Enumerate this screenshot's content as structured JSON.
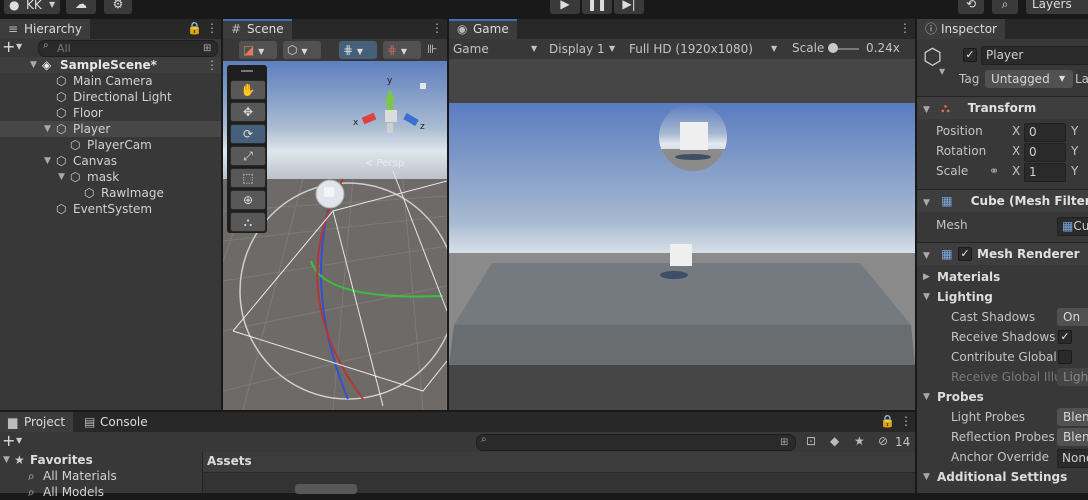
{
  "topbar": {
    "account": "KK",
    "layers": "Layers"
  },
  "hierarchy": {
    "tab": "Hierarchy",
    "search_placeholder": "All",
    "scene": "SampleScene*",
    "items": [
      {
        "label": "Main Camera"
      },
      {
        "label": "Directional Light"
      },
      {
        "label": "Floor"
      },
      {
        "label": "Player"
      },
      {
        "label": "PlayerCam"
      },
      {
        "label": "Canvas"
      },
      {
        "label": "mask"
      },
      {
        "label": "RawImage"
      },
      {
        "label": "EventSystem"
      }
    ]
  },
  "scene": {
    "tab": "Scene",
    "persp": "< Persp",
    "gizmo_axes": [
      "y",
      "x",
      "z"
    ]
  },
  "game": {
    "tab": "Game",
    "mode": "Game",
    "display": "Display 1",
    "resolution": "Full HD (1920x1080)",
    "scale_label": "Scale",
    "scale_value": "0.24x",
    "scale_fraction": 0.12
  },
  "inspector": {
    "tab": "Inspector",
    "object_name": "Player",
    "tag_label": "Tag",
    "tag_value": "Untagged",
    "layer_label": "La",
    "transform": {
      "title": "Transform",
      "position_label": "Position",
      "rotation_label": "Rotation",
      "scale_label": "Scale",
      "x_label": "X",
      "y_label": "Y",
      "position_x": "0",
      "rotation_x": "0",
      "scale_x": "1"
    },
    "mesh_filter": {
      "title": "Cube (Mesh Filter)",
      "mesh_label": "Mesh",
      "mesh_value": "Cu"
    },
    "mesh_renderer": {
      "title": "Mesh Renderer",
      "materials": "Materials",
      "lighting": "Lighting",
      "cast_shadows_label": "Cast Shadows",
      "cast_shadows_value": "On",
      "receive_shadows_label": "Receive Shadows",
      "contribute_gi_label": "Contribute Global I",
      "receive_gi_label": "Receive Global Illu",
      "receive_gi_value": "Light",
      "probes": "Probes",
      "light_probes_label": "Light Probes",
      "light_probes_value": "Blen",
      "reflection_probes_label": "Reflection Probes",
      "reflection_probes_value": "Blen",
      "anchor_override_label": "Anchor Override",
      "anchor_override_value": "None",
      "additional_settings": "Additional Settings"
    }
  },
  "project": {
    "tab_project": "Project",
    "tab_console": "Console",
    "favorites": "Favorites",
    "fav_items": [
      {
        "label": "All Materials"
      },
      {
        "label": "All Models"
      }
    ],
    "assets": "Assets",
    "hidden_count": "14"
  }
}
